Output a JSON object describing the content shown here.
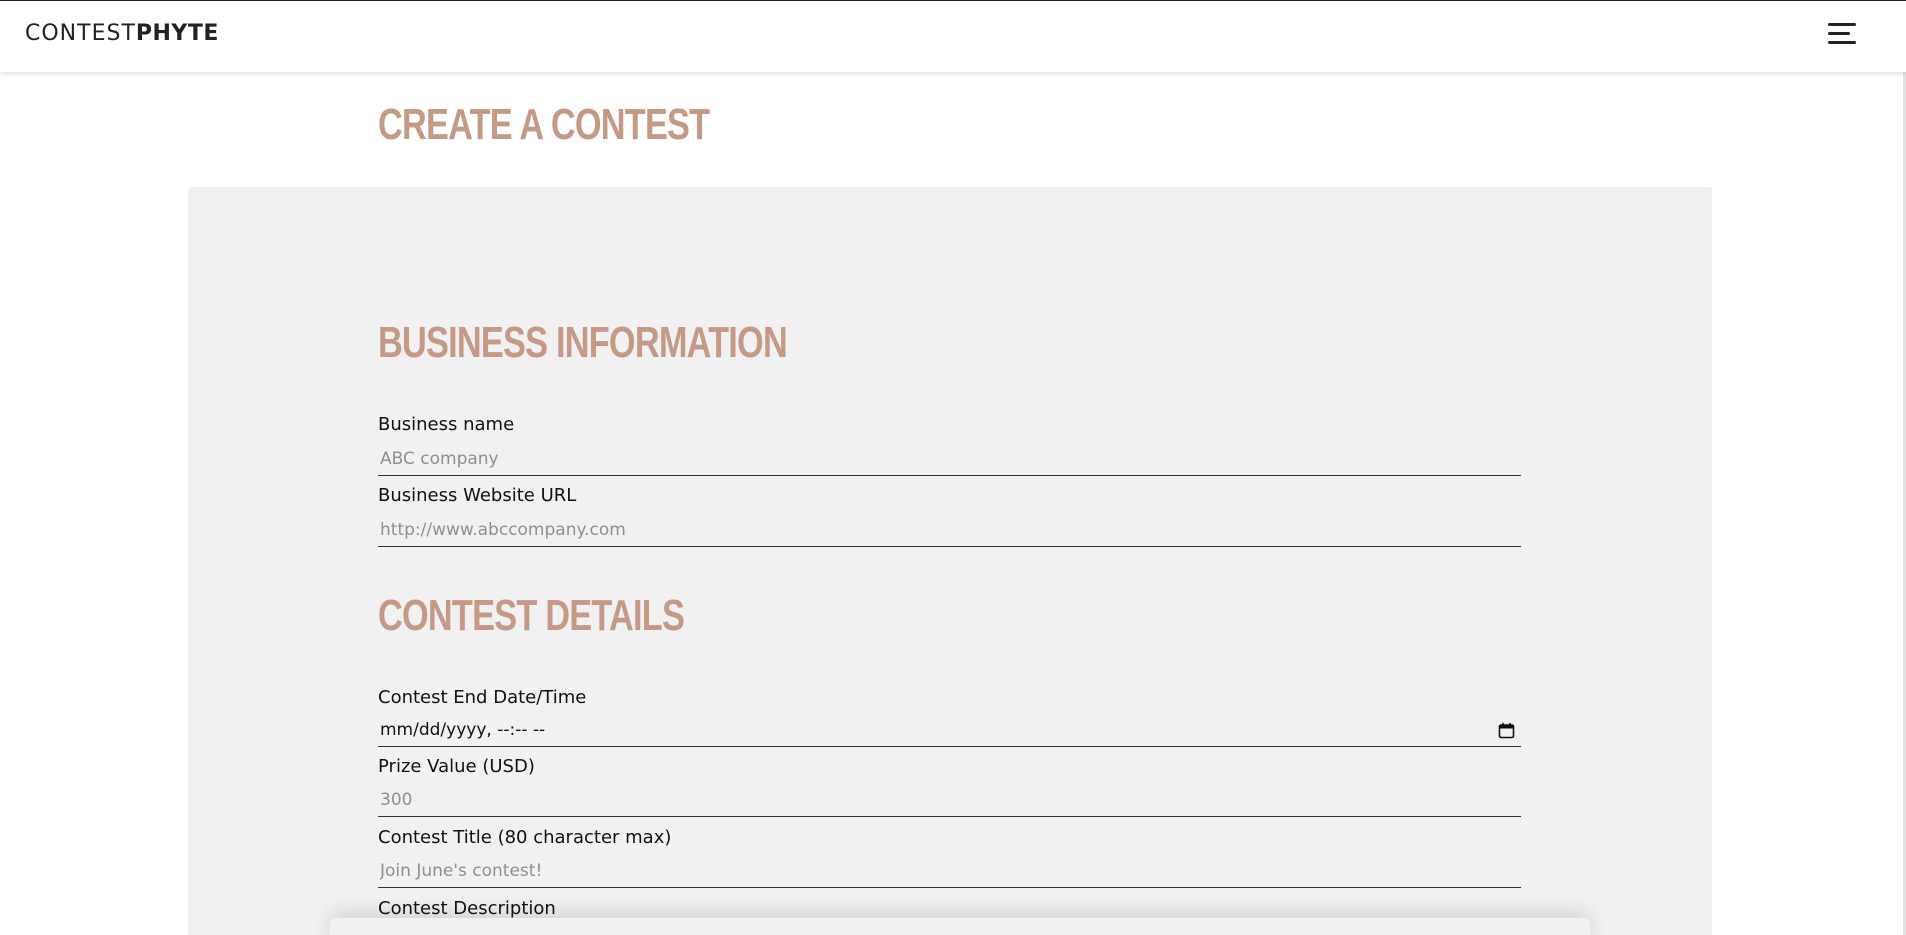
{
  "header": {
    "logo_light": "CONTEST",
    "logo_bold": "PHYTE",
    "menu_icon": "hamburger-menu-icon"
  },
  "page": {
    "title": "Create a Contest"
  },
  "business": {
    "section_title": "Business Information",
    "name_label": "Business name",
    "name_placeholder": "ABC company",
    "url_label": "Business Website URL",
    "url_placeholder": "http://www.abccompany.com"
  },
  "contest": {
    "section_title": "Contest Details",
    "end_label": "Contest End Date/Time",
    "end_value": "mm/dd/yyyy, --:-- --",
    "prize_label": "Prize Value (USD)",
    "prize_placeholder": "300",
    "title_label": "Contest Title (80 character max)",
    "title_placeholder": "Join June's contest!",
    "description_label": "Contest Description"
  },
  "colors": {
    "accent": "#c49a86",
    "panel_bg": "#f1f1f1"
  }
}
